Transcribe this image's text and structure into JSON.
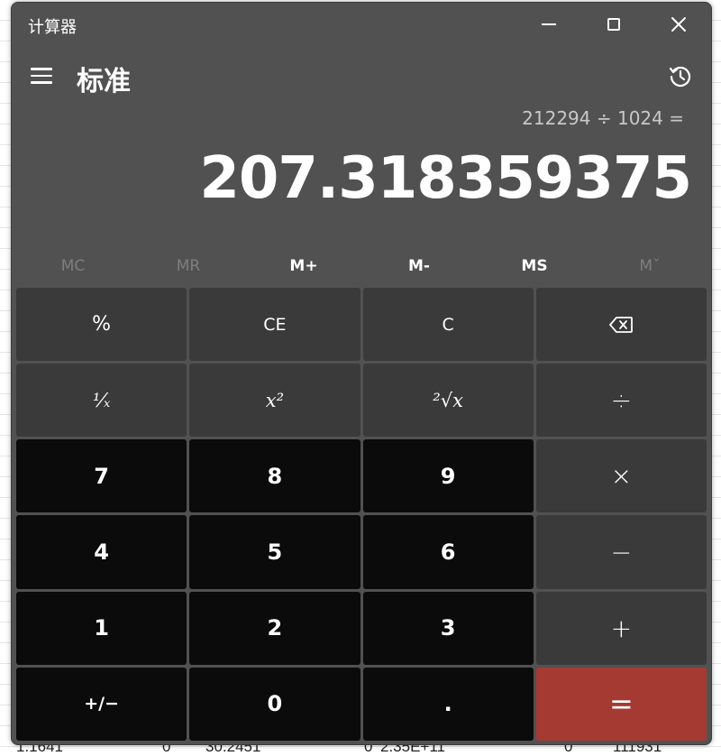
{
  "window": {
    "app_title": "计算器",
    "mode_title": "标准"
  },
  "display": {
    "expression": "212294 ÷ 1024 =",
    "result": "207.318359375"
  },
  "memory": [
    {
      "label": "MC",
      "enabled": false
    },
    {
      "label": "MR",
      "enabled": false
    },
    {
      "label": "M+",
      "enabled": true
    },
    {
      "label": "M-",
      "enabled": true
    },
    {
      "label": "MS",
      "enabled": true
    },
    {
      "label": "Mˇ",
      "enabled": false
    }
  ],
  "keypad": {
    "percent": "%",
    "ce": "CE",
    "c": "C",
    "backspace": "backspace-icon",
    "reciprocal": "¹⁄ₓ",
    "square": "x²",
    "sqrt": "²√x",
    "divide": "÷",
    "seven": "7",
    "eight": "8",
    "nine": "9",
    "multiply": "×",
    "four": "4",
    "five": "5",
    "six": "6",
    "minus": "−",
    "one": "1",
    "two": "2",
    "three": "3",
    "plus": "+",
    "negate": "+/−",
    "zero": "0",
    "decimal": ".",
    "equals": "="
  },
  "background_sheet": {
    "cells": [
      "1.1641",
      "0",
      "30.2451",
      "0",
      "2.35E+11",
      "0",
      "111931"
    ]
  },
  "colors": {
    "window_bg": "#515151",
    "function_key": "#3a3a3a",
    "number_key": "#0b0b0b",
    "equals_key": "#a53a32"
  }
}
